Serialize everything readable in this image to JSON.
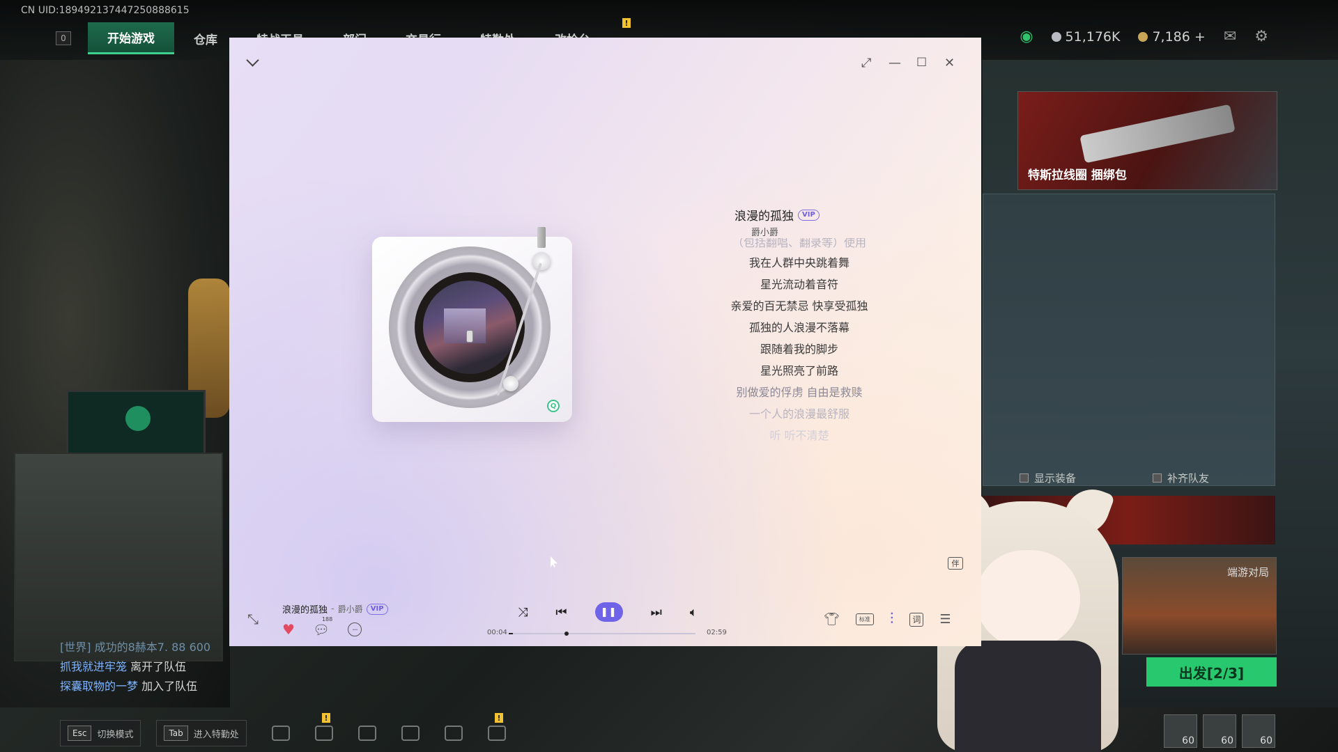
{
  "game": {
    "uid": "CN UID:189492137447250888615",
    "tab_key": "0",
    "tabs": [
      "开始游戏",
      "仓库",
      "特战干员",
      "部门",
      "交易行",
      "特勤处",
      "改枪台"
    ],
    "currency_silver": "51,176K",
    "currency_gold": "7,186 +",
    "promo_text": "特斯拉线圈 捆绑包",
    "option_show_gear": "显示装备",
    "option_fill_team": "补齐队友",
    "mode_label": "端游对局",
    "go_button": "出发[2/3]",
    "squad_levels": [
      "60",
      "60",
      "60"
    ],
    "chat": [
      {
        "prefix": "[世界]",
        "text": "成功的8赫本7. 88 600"
      },
      {
        "name": "抓我就进牢笼",
        "text": "离开了队伍"
      },
      {
        "name": "探囊取物的一梦",
        "text": "加入了队伍"
      }
    ],
    "bottom": {
      "esc_key": "Esc",
      "esc_label": "切换模式",
      "tab_key": "Tab",
      "tab_label": "进入特勤处"
    }
  },
  "player": {
    "song_title": "浪漫的孤独",
    "vip_label": "VIP",
    "artist": "爵小爵",
    "accompaniment_label": "伴",
    "lyrics": [
      "（包括翻唱、翻录等）使用",
      "我在人群中央跳着舞",
      "星光流动着音符",
      "亲爱的百无禁忌 快享受孤独",
      "孤独的人浪漫不落幕",
      "跟随着我的脚步",
      "星光照亮了前路",
      "别做爱的俘虏 自由是救赎",
      "一个人的浪漫最舒服",
      "听 听不清楚"
    ],
    "comment_count": "188",
    "time_current": "00:04",
    "time_total": "02:59",
    "progress": 0.022,
    "quality_label": "标准",
    "lyric_button": "词",
    "accent_color": "#6f63e8"
  }
}
